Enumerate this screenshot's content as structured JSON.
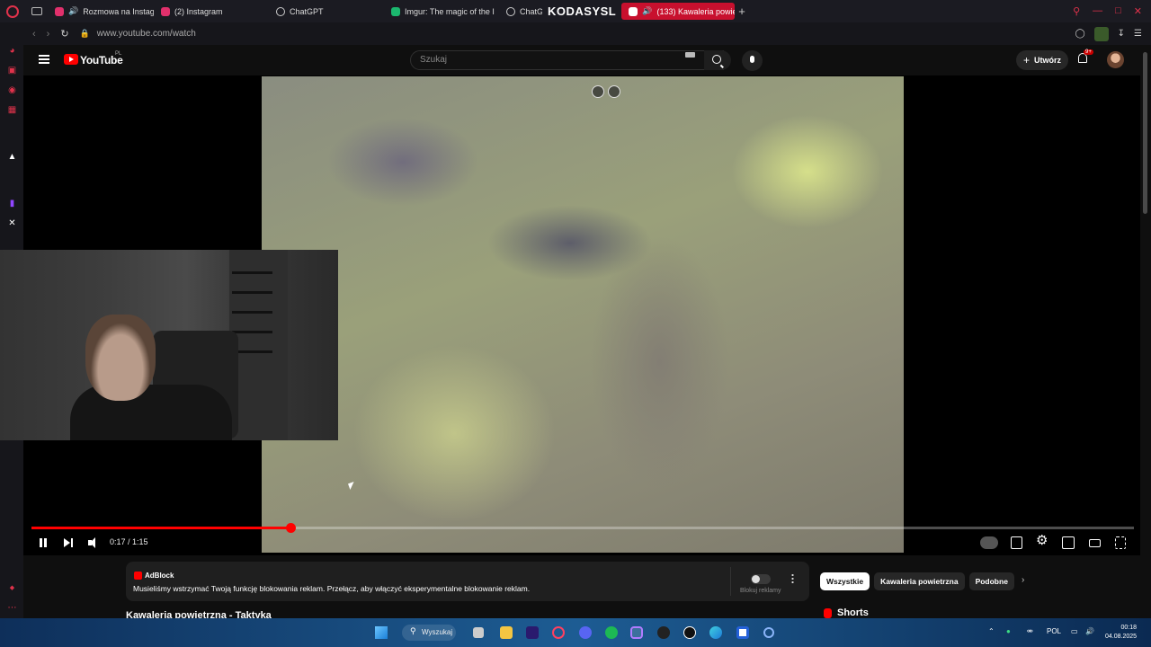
{
  "browser": {
    "tabs": [
      {
        "label": "Rozmowa na Instagra",
        "color": "#e1306c"
      },
      {
        "label": "(2) Instagram",
        "color": "#e1306c"
      },
      {
        "label": "ChatGPT",
        "color": "#cccccc"
      },
      {
        "label": "Imgur: The magic of the I",
        "color": "#1bb76e"
      },
      {
        "label": "ChatG",
        "color": "#cccccc"
      },
      {
        "label": "(133) Kawaleria powie",
        "color": "#ff0000"
      }
    ],
    "brand_overlay": "KODASYSL",
    "new_tab": "+",
    "url": "www.youtube.com/watch"
  },
  "youtube": {
    "logo_text": "YouTube",
    "region": "PL",
    "search_placeholder": "Szukaj",
    "create_label": "Utwórz",
    "notification_count": "9+"
  },
  "player": {
    "current_time": "0:17",
    "duration": "1:15",
    "time_display": "0:17 / 1:15",
    "progress": 0.235,
    "accent_color": "#ff0000"
  },
  "adblock": {
    "title": "AdBlock",
    "message": "Musieliśmy wstrzymać Twoją funkcję blokowania reklam. Przełącz, aby włączyć eksperymentalne blokowanie reklam.",
    "toggle_label": "Blokuj reklamy"
  },
  "video": {
    "title": "Kawaleria powietrzna - Taktyka"
  },
  "chips": [
    "Wszystkie",
    "Kawaleria powietrzna",
    "Podobne"
  ],
  "shorts_label": "Shorts",
  "taskbar": {
    "search_label": "Wyszukaj",
    "language": "POL",
    "time": "00:18",
    "date": "04.08.2025"
  }
}
